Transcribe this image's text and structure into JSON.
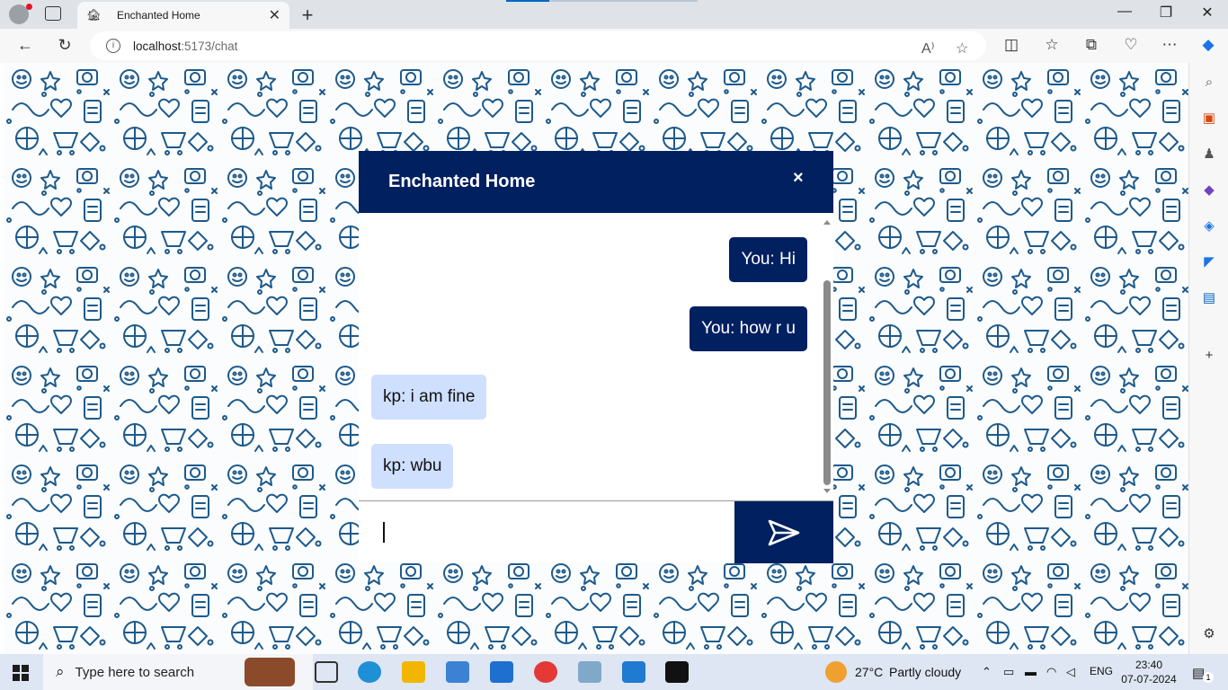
{
  "browser": {
    "tab_title": "Enchanted Home",
    "url_host": "localhost",
    "url_path": ":5173/chat"
  },
  "chat": {
    "title": "Enchanted Home",
    "close_label": "×",
    "messages": [
      {
        "text": "You: Hi",
        "from": "me"
      },
      {
        "text": "You: how r u",
        "from": "me"
      },
      {
        "text": "kp: i am fine",
        "from": "them"
      },
      {
        "text": "kp: wbu",
        "from": "them"
      }
    ],
    "input_value": "",
    "send_icon": "send-icon"
  },
  "colors": {
    "brand": "#002060",
    "incoming_bubble": "#cfe0ff",
    "doodle": "#1d5a8c"
  },
  "taskbar": {
    "search_placeholder": "Type here to search",
    "weather_temp": "27°C",
    "weather_text": "Partly cloudy",
    "language": "ENG",
    "time": "23:40",
    "date": "07-07-2024",
    "notification_count": "1"
  }
}
